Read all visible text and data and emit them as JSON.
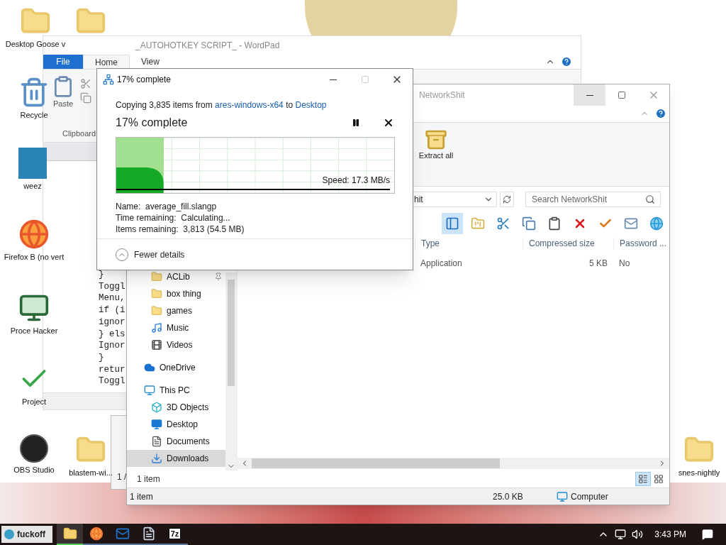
{
  "desktop_icons": [
    {
      "kind": "folder",
      "label": "Desktop Goose v"
    },
    {
      "kind": "folder"
    },
    {
      "kind": "recycle",
      "label": "Recycle"
    },
    {
      "kind": "image",
      "label": "weez"
    },
    {
      "kind": "firefox",
      "label": "Firefox B (no vert"
    },
    {
      "kind": "monitor",
      "label": "Proce Hacker"
    },
    {
      "kind": "project",
      "label": "Project"
    },
    {
      "kind": "obs",
      "label": "OBS Studio"
    },
    {
      "kind": "folder",
      "label": "blastem-wi..."
    },
    {
      "kind": "folder",
      "label": "snes-nightly"
    }
  ],
  "wordpad": {
    "title": "_AUTOHOTKEY SCRIPT_ - WordPad",
    "tabs": [
      {
        "label": "File",
        "kind": "file",
        "selected": false
      },
      {
        "label": "Home",
        "kind": "tab",
        "selected": true
      },
      {
        "label": "View",
        "kind": "tab",
        "selected": false
      }
    ],
    "paste": "Paste",
    "group": "Clipboard",
    "code": [
      "}",
      "Toggl",
      "Menu,",
      "if (i",
      "ignor",
      "} els",
      "Ignor",
      "}",
      "retur",
      "Toggl"
    ]
  },
  "back_window": {
    "status": "1 /"
  },
  "explorer": {
    "title": "NetworkShit",
    "address": "hit",
    "search": {
      "placeholder": "Search NetworkShit"
    },
    "extract": "Extract all",
    "toolbar": [
      {
        "kind": "pane",
        "selected": true
      },
      {
        "kind": "properties",
        "selected": false
      },
      {
        "kind": "cut",
        "selected": false
      },
      {
        "kind": "copy",
        "selected": false
      },
      {
        "kind": "paste",
        "selected": false
      },
      {
        "kind": "delete",
        "selected": false
      },
      {
        "kind": "check",
        "selected": false
      },
      {
        "kind": "mail",
        "selected": false
      },
      {
        "kind": "globe",
        "selected": false
      }
    ],
    "columns": [
      "Type",
      "Compressed size",
      "Password ..."
    ],
    "rows": [
      [
        "Application",
        "5 KB",
        "No"
      ]
    ],
    "quick_access": [
      {
        "label": "ACLib",
        "kind": "folder",
        "pinned": true,
        "selected": false
      },
      {
        "label": "box thing",
        "kind": "folder",
        "pinned": false,
        "selected": false
      },
      {
        "label": "games",
        "kind": "folder",
        "pinned": false,
        "selected": false
      },
      {
        "label": "Music",
        "kind": "music",
        "pinned": false,
        "selected": false
      },
      {
        "label": "Videos",
        "kind": "video",
        "pinned": false,
        "selected": false
      }
    ],
    "nav": [
      {
        "label": "OneDrive",
        "kind": "cloud",
        "selected": false
      },
      {
        "label": "This PC",
        "kind": "pc",
        "selected": false,
        "children": [
          {
            "label": "3D Objects",
            "kind": "objects",
            "selected": false
          },
          {
            "label": "Desktop",
            "kind": "desktop",
            "selected": false
          },
          {
            "label": "Documents",
            "kind": "documents",
            "selected": false
          },
          {
            "label": "Downloads",
            "kind": "downloads",
            "selected": true
          }
        ]
      }
    ],
    "inner_status": "1 item",
    "views": [
      {
        "kind": "details",
        "selected": true
      },
      {
        "kind": "tiles",
        "selected": false
      }
    ],
    "status": {
      "items": "1 item",
      "size": "25.0 KB",
      "zone": "Computer"
    }
  },
  "copy_dialog": {
    "title": "17% complete",
    "copy_prefix": "Copying 3,835 items from",
    "source": "ares-windows-x64",
    "joiner": "to",
    "destination": "Desktop",
    "heading": "17% complete",
    "level": 0.17,
    "speed": "Speed: 17.3 MB/s",
    "details": [
      {
        "label": "Name:",
        "value": "average_fill.slangp"
      },
      {
        "label": "Time remaining:",
        "value": "Calculating..."
      },
      {
        "label": "Items remaining:",
        "value": "3,813 (54.5 MB)"
      }
    ],
    "toggle": "Fewer details"
  },
  "taskbar": {
    "start": "fuckoff",
    "apps": [
      {
        "kind": "folder",
        "selected": true
      },
      {
        "kind": "firefox",
        "selected": false
      },
      {
        "kind": "outlook",
        "selected": false
      },
      {
        "kind": "notepad",
        "selected": false
      },
      {
        "kind": "sevenzip",
        "selected": false,
        "label": "7z"
      }
    ],
    "clock": "3:43 PM"
  }
}
